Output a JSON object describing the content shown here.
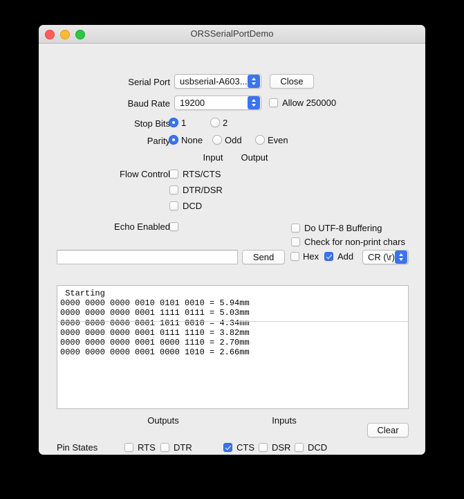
{
  "window": {
    "title": "ORSSerialPortDemo",
    "traffic_lights": [
      "close-button",
      "minimize-button",
      "zoom-button"
    ]
  },
  "serial_port": {
    "label": "Serial Port",
    "selected": "usbserial-A603...",
    "connect_button": "Close"
  },
  "baud_rate": {
    "label": "Baud Rate",
    "selected": "19200",
    "allow_250000": {
      "label": "Allow 250000",
      "checked": false
    }
  },
  "stop_bits": {
    "label": "Stop Bits",
    "options": [
      {
        "label": "1",
        "selected": true
      },
      {
        "label": "2",
        "selected": false
      }
    ]
  },
  "parity": {
    "label": "Parity",
    "options": [
      {
        "label": "None",
        "selected": true
      },
      {
        "label": "Odd",
        "selected": false
      },
      {
        "label": "Even",
        "selected": false
      }
    ]
  },
  "flow_control": {
    "label": "Flow Control",
    "column_headers": [
      "Input",
      "Output"
    ],
    "options": [
      {
        "label": "RTS/CTS",
        "checked": false
      },
      {
        "label": "DTR/DSR",
        "checked": false
      },
      {
        "label": "DCD",
        "checked": false
      }
    ]
  },
  "echo": {
    "label": "Echo Enabled",
    "checked": false
  },
  "buffering": {
    "utf8": {
      "label": "Do UTF-8 Buffering",
      "checked": false
    },
    "nonprint": {
      "label": "Check for non-print chars",
      "checked": false
    }
  },
  "send_row": {
    "input_value": "",
    "input_placeholder": "",
    "send_button": "Send",
    "hex": {
      "label": "Hex",
      "checked": false
    },
    "add": {
      "label": "Add",
      "checked": true
    },
    "terminator": {
      "selected": "CR (\\r)"
    }
  },
  "terminal": {
    "lines": [
      " Starting",
      "0000 0000 0000 0010 0101 0010 = 5.94mm",
      "0000 0000 0000 0001 1111 0111 = 5.03mm",
      "0000 0000 0000 0001 1011 0010 = 4.34mm",
      "0000 0000 0000 0001 0111 1110 = 3.82mm",
      "0000 0000 0000 0001 0000 1110 = 2.70mm",
      "0000 0000 0000 0001 0000 1010 = 2.66mm"
    ]
  },
  "pin_states": {
    "label": "Pin States",
    "outputs_header": "Outputs",
    "inputs_header": "Inputs",
    "clear_button": "Clear",
    "outputs": [
      {
        "label": "RTS",
        "checked": false
      },
      {
        "label": "DTR",
        "checked": false
      }
    ],
    "inputs": [
      {
        "label": "CTS",
        "checked": true
      },
      {
        "label": "DSR",
        "checked": false
      },
      {
        "label": "DCD",
        "checked": false
      }
    ]
  },
  "colors": {
    "accent": "#3b73f0",
    "window_bg": "#ececec",
    "titlebar_bg": "#e0e0e0",
    "desktop_bg": "#000000"
  }
}
